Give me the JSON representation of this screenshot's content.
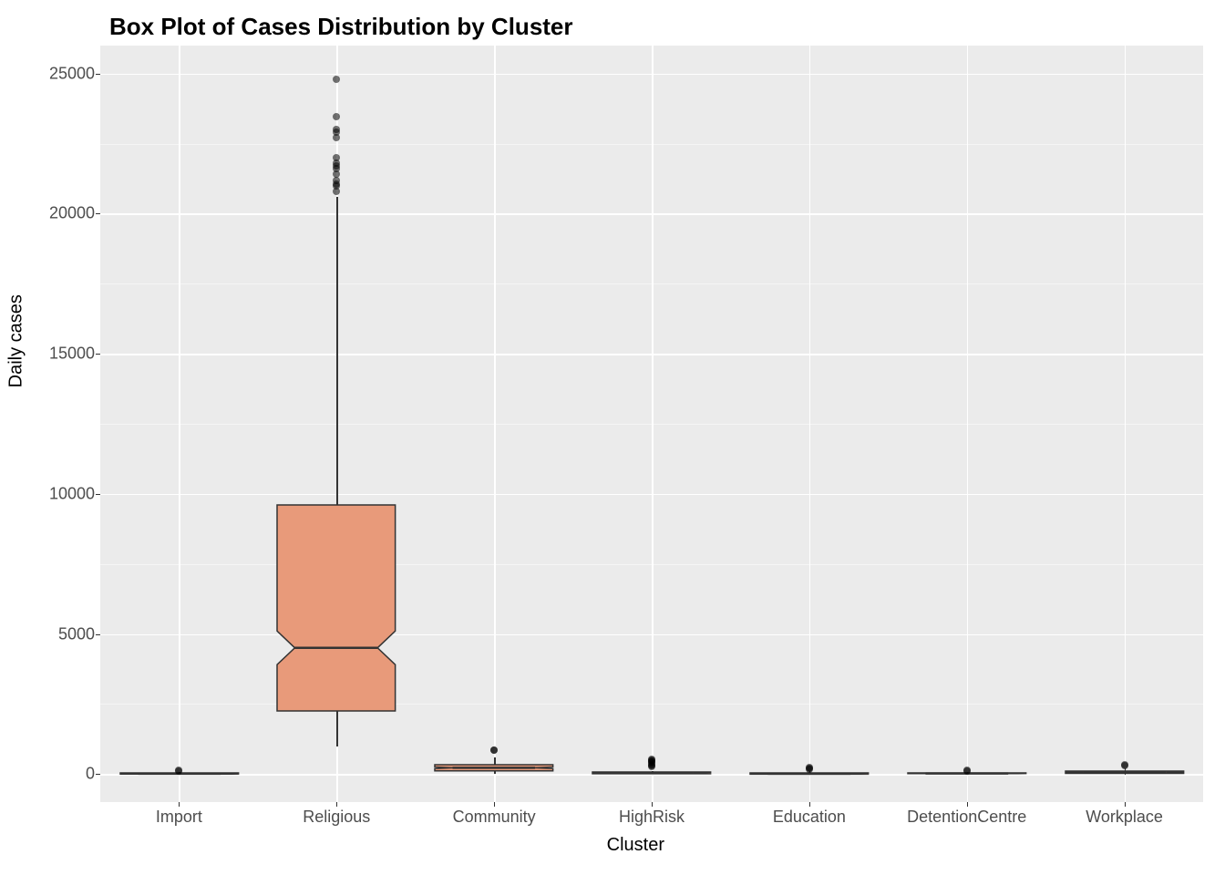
{
  "chart_data": {
    "type": "box",
    "title": "Box Plot of Cases Distribution by Cluster",
    "xlabel": "Cluster",
    "ylabel": "Daily cases",
    "ylim": [
      -1000,
      26000
    ],
    "y_ticks": [
      0,
      5000,
      10000,
      15000,
      20000,
      25000
    ],
    "categories": [
      "Import",
      "Religious",
      "Community",
      "HighRisk",
      "Education",
      "DetentionCentre",
      "Workplace"
    ],
    "boxes": [
      {
        "category": "Import",
        "q1": 0,
        "median": 10,
        "q3": 40,
        "lower_whisker": 0,
        "upper_whisker": 80,
        "notch_lower": 5,
        "notch_upper": 20,
        "outliers": [
          120,
          130
        ]
      },
      {
        "category": "Religious",
        "q1": 2250,
        "median": 4500,
        "q3": 9600,
        "lower_whisker": 1000,
        "upper_whisker": 20600,
        "notch_lower": 3900,
        "notch_upper": 5100,
        "outliers": [
          20800,
          21000,
          21050,
          21200,
          21400,
          21600,
          21700,
          21800,
          22000,
          22700,
          22900,
          23000,
          23450,
          24800
        ]
      },
      {
        "category": "Community",
        "q1": 120,
        "median": 230,
        "q3": 340,
        "lower_whisker": 0,
        "upper_whisker": 600,
        "notch_lower": 200,
        "notch_upper": 260,
        "outliers": [
          850,
          870
        ]
      },
      {
        "category": "HighRisk",
        "q1": 0,
        "median": 20,
        "q3": 60,
        "lower_whisker": 0,
        "upper_whisker": 120,
        "notch_lower": 10,
        "notch_upper": 30,
        "outliers": [
          280,
          300,
          350,
          400,
          420,
          470,
          500,
          530
        ]
      },
      {
        "category": "Education",
        "q1": 0,
        "median": 15,
        "q3": 45,
        "lower_whisker": 0,
        "upper_whisker": 100,
        "notch_lower": 10,
        "notch_upper": 25,
        "outliers": [
          180,
          200,
          230
        ]
      },
      {
        "category": "DetentionCentre",
        "q1": 0,
        "median": 5,
        "q3": 25,
        "lower_whisker": 0,
        "upper_whisker": 60,
        "notch_lower": 3,
        "notch_upper": 12,
        "outliers": [
          120,
          140
        ]
      },
      {
        "category": "Workplace",
        "q1": 10,
        "median": 40,
        "q3": 90,
        "lower_whisker": 0,
        "upper_whisker": 200,
        "notch_lower": 30,
        "notch_upper": 55,
        "outliers": [
          300,
          350
        ]
      }
    ],
    "fill_color": "#e89a7a"
  }
}
